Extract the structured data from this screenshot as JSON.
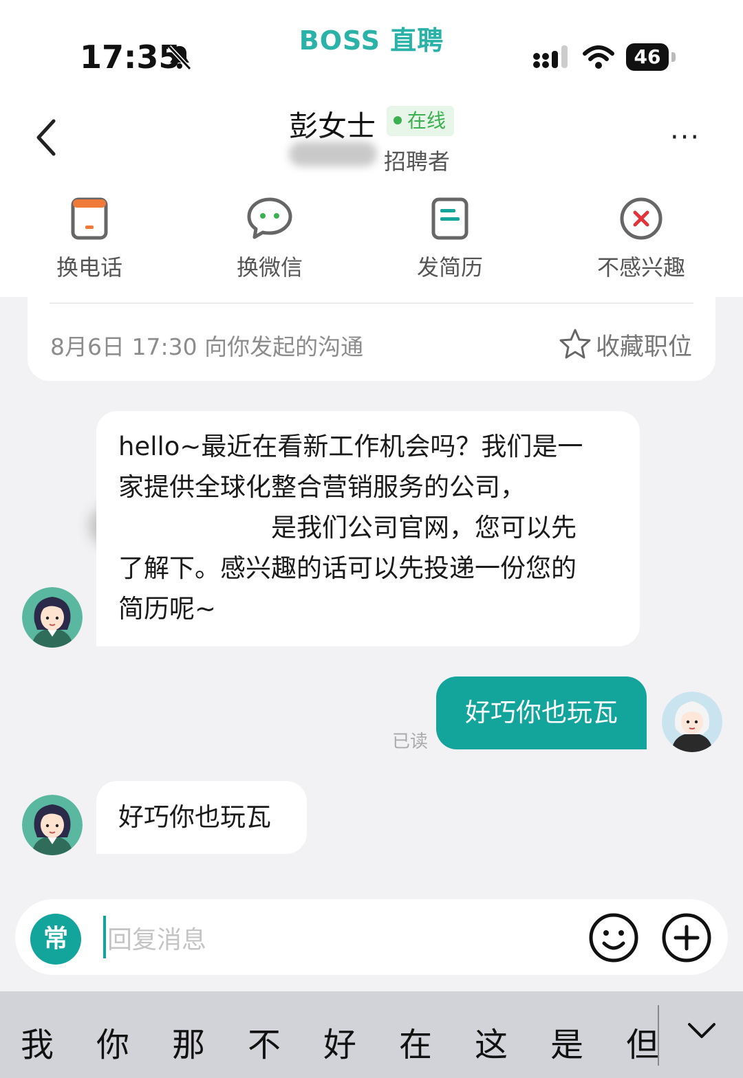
{
  "status_bar": {
    "time": "17:35",
    "battery": "46",
    "app_mark": "BOSS 直聘"
  },
  "header": {
    "name": "彭女士",
    "online_label": "在线",
    "role": "招聘者",
    "more_label": "···"
  },
  "actions": [
    {
      "label": "换电话",
      "icon": "phone-icon"
    },
    {
      "label": "换微信",
      "icon": "wechat-icon"
    },
    {
      "label": "发简历",
      "icon": "resume-icon"
    },
    {
      "label": "不感兴趣",
      "icon": "not-interested-icon"
    }
  ],
  "card": {
    "info": "8月6日 17:30 向你发起的沟通",
    "favorite_label": "收藏职位"
  },
  "messages": [
    {
      "sender": "recruiter",
      "lines": [
        "hello~最近在看新工作机会吗？我们是一",
        "家提供全球化整合营销服务的公司，",
        "是我们公司官网，您可以先",
        "了解下。感兴趣的话可以先投递一份您的",
        "简历呢~"
      ]
    },
    {
      "sender": "me",
      "text": "好巧你也玩瓦",
      "status": "已读"
    },
    {
      "sender": "recruiter",
      "text": "好巧你也玩瓦"
    }
  ],
  "input": {
    "quick_label": "常",
    "placeholder": "回复消息"
  },
  "keyboard": {
    "candidates": [
      "我",
      "你",
      "那",
      "不",
      "好",
      "在",
      "这",
      "是",
      "但"
    ]
  },
  "colors": {
    "accent": "#13a49c",
    "online": "#3bb04f",
    "danger": "#e5333a",
    "phone_orange": "#f07a3a"
  }
}
